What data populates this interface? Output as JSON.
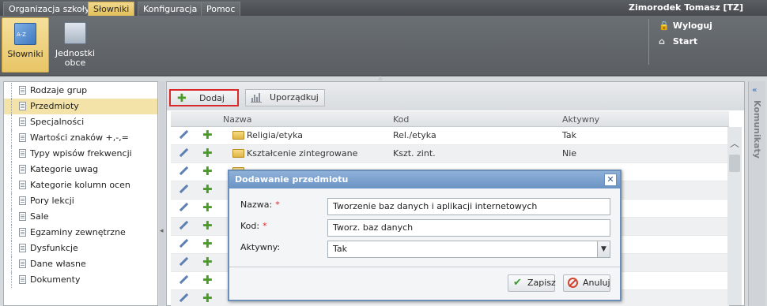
{
  "menu": {
    "tabs": [
      {
        "label": "Organizacja szkoły"
      },
      {
        "label": "Słowniki"
      },
      {
        "label": "Konfiguracja"
      },
      {
        "label": "Pomoc"
      }
    ],
    "user": "Zimorodek Tomasz [TZ]"
  },
  "ribbon": {
    "slowniki_label": "Słowniki",
    "jednostki_line1": "Jednostki",
    "jednostki_line2": "obce",
    "wyloguj": "Wyloguj",
    "start": "Start"
  },
  "sidebar": {
    "items": [
      {
        "label": "Rodzaje grup"
      },
      {
        "label": "Przedmioty"
      },
      {
        "label": "Specjalności"
      },
      {
        "label": "Wartości znaków +,-,="
      },
      {
        "label": "Typy wpisów frekwencji"
      },
      {
        "label": "Kategorie uwag"
      },
      {
        "label": "Kategorie kolumn ocen"
      },
      {
        "label": "Pory lekcji"
      },
      {
        "label": "Sale"
      },
      {
        "label": "Egzaminy zewnętrzne"
      },
      {
        "label": "Dysfunkcje"
      },
      {
        "label": "Dane własne"
      },
      {
        "label": "Dokumenty"
      }
    ]
  },
  "toolbar": {
    "add_label": "Dodaj",
    "order_label": "Uporządkuj"
  },
  "grid": {
    "columns": {
      "name": "Nazwa",
      "code": "Kod",
      "active": "Aktywny"
    },
    "rows": [
      {
        "name": "Religia/etyka",
        "code": "Rel./etyka",
        "active": "Tak"
      },
      {
        "name": "Kształcenie zintegrowane",
        "code": "Kszt. zint.",
        "active": "Nie"
      }
    ]
  },
  "rail": {
    "label": "Komunikaty"
  },
  "dialog": {
    "title": "Dodawanie przedmiotu",
    "name_label": "Nazwa:",
    "code_label": "Kod:",
    "active_label": "Aktywny:",
    "required_mark": "*",
    "name_value": "Tworzenie baz danych i aplikacji internetowych",
    "code_value": "Tworz. baz danych",
    "active_value": "Tak",
    "save_label": "Zapisz",
    "cancel_label": "Anuluj"
  },
  "colors": {
    "active_tab": "#e2bf5a",
    "dialog_title": "#6a93c4",
    "highlight_border": "#d8282b",
    "add_icon": "#4c9a2a"
  }
}
